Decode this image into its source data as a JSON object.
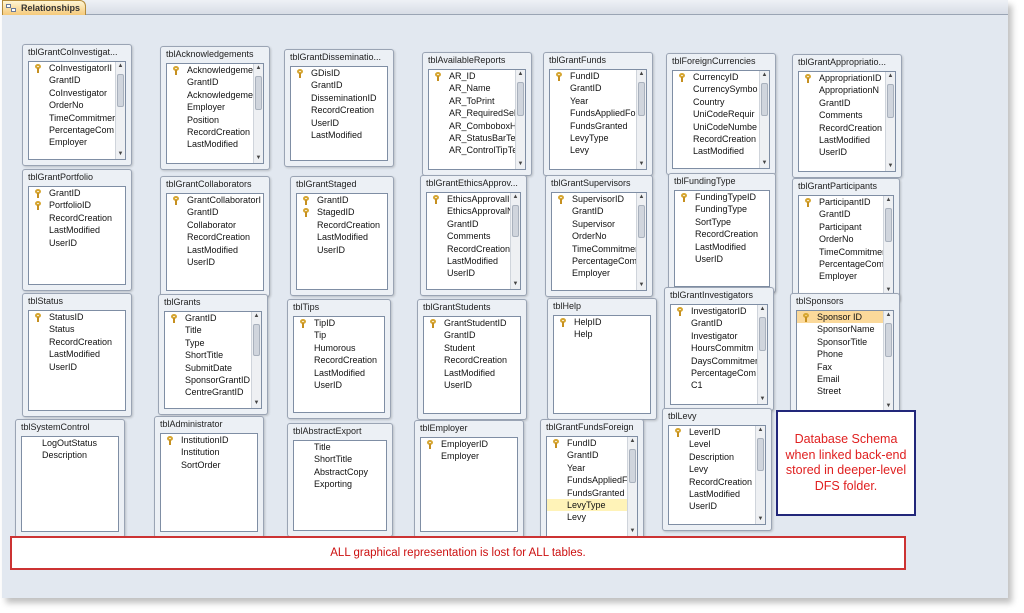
{
  "tab": {
    "label": "Relationships",
    "icon": "relationships-icon"
  },
  "tables": [
    {
      "name": "tblGrantCoInvestigat...",
      "fields": [
        "CoInvestigatorII",
        "GrantID",
        "CoInvestigator",
        "OrderNo",
        "TimeCommitmer",
        "PercentageCom",
        "Employer"
      ],
      "key": [
        0
      ],
      "scroll": true
    },
    {
      "name": "tblAcknowledgements",
      "fields": [
        "Acknowledgeme",
        "GrantID",
        "Acknowledgeme",
        "Employer",
        "Position",
        "RecordCreation",
        "LastModified"
      ],
      "key": [
        0
      ],
      "scroll": true
    },
    {
      "name": "tblGrantDisseminatio...",
      "fields": [
        "GDisID",
        "GrantID",
        "DisseminationID",
        "RecordCreation",
        "UserID",
        "LastModified"
      ],
      "key": [
        0
      ],
      "scroll": false
    },
    {
      "name": "tblAvailableReports",
      "fields": [
        "AR_ID",
        "AR_Name",
        "AR_ToPrint",
        "AR_RequiredSel",
        "AR_ComboboxH",
        "AR_StatusBarTe",
        "AR_ControlTipTe"
      ],
      "key": [
        0
      ],
      "scroll": true
    },
    {
      "name": "tblGrantFunds",
      "fields": [
        "FundID",
        "GrantID",
        "Year",
        "FundsAppliedFo",
        "FundsGranted",
        "LevyType",
        "Levy"
      ],
      "key": [
        0
      ],
      "scroll": true
    },
    {
      "name": "tblForeignCurrencies",
      "fields": [
        "CurrencyID",
        "CurrencySymbo",
        "Country",
        "UniCodeRequir",
        "UniCodeNumbe",
        "RecordCreation",
        "LastModified"
      ],
      "key": [
        0
      ],
      "scroll": true
    },
    {
      "name": "tblGrantAppropriatio...",
      "fields": [
        "AppropriationID",
        "AppropriationN",
        "GrantID",
        "Comments",
        "RecordCreation",
        "LastModified",
        "UserID"
      ],
      "key": [
        0
      ],
      "scroll": true
    },
    {
      "name": "tblGrantPortfolio",
      "fields": [
        "GrantID",
        "PortfolioID",
        "RecordCreation",
        "LastModified",
        "UserID"
      ],
      "key": [
        0,
        1
      ],
      "scroll": false
    },
    {
      "name": "tblGrantCollaborators",
      "fields": [
        "GrantCollaboratorI",
        "GrantID",
        "Collaborator",
        "RecordCreation",
        "LastModified",
        "UserID"
      ],
      "key": [
        0
      ],
      "scroll": false
    },
    {
      "name": "tblGrantStaged",
      "fields": [
        "GrantID",
        "StagedID",
        "RecordCreation",
        "LastModified",
        "UserID"
      ],
      "key": [
        0,
        1
      ],
      "scroll": false
    },
    {
      "name": "tblGrantEthicsApprov...",
      "fields": [
        "EthicsApprovalI",
        "EthicsApprovalN",
        "GrantID",
        "Comments",
        "RecordCreation",
        "LastModified",
        "UserID"
      ],
      "key": [
        0
      ],
      "scroll": true
    },
    {
      "name": "tblGrantSupervisors",
      "fields": [
        "SupervisorID",
        "GrantID",
        "Supervisor",
        "OrderNo",
        "TimeCommitmer",
        "PercentageCom",
        "Employer"
      ],
      "key": [
        0
      ],
      "scroll": true
    },
    {
      "name": "tblFundingType",
      "fields": [
        "FundingTypeID",
        "FundingType",
        "SortType",
        "RecordCreation",
        "LastModified",
        "UserID"
      ],
      "key": [
        0
      ],
      "scroll": false
    },
    {
      "name": "tblGrantParticipants",
      "fields": [
        "ParticipantID",
        "GrantID",
        "Participant",
        "OrderNo",
        "TimeCommitmer",
        "PercentageCom",
        "Employer"
      ],
      "key": [
        0
      ],
      "scroll": true
    },
    {
      "name": "tblStatus",
      "fields": [
        "StatusID",
        "Status",
        "RecordCreation",
        "LastModified",
        "UserID"
      ],
      "key": [
        0
      ],
      "scroll": false
    },
    {
      "name": "tblGrants",
      "fields": [
        "GrantID",
        "Title",
        "Type",
        "ShortTitle",
        "SubmitDate",
        "SponsorGrantID",
        "CentreGrantID"
      ],
      "key": [
        0
      ],
      "scroll": true
    },
    {
      "name": "tblTips",
      "fields": [
        "TipID",
        "Tip",
        "Humorous",
        "RecordCreation",
        "LastModified",
        "UserID"
      ],
      "key": [
        0
      ],
      "scroll": false
    },
    {
      "name": "tblGrantStudents",
      "fields": [
        "GrantStudentID",
        "GrantID",
        "Student",
        "RecordCreation",
        "LastModified",
        "UserID"
      ],
      "key": [
        0
      ],
      "scroll": false
    },
    {
      "name": "tblHelp",
      "fields": [
        "HelpID",
        "Help"
      ],
      "key": [
        0
      ],
      "scroll": false
    },
    {
      "name": "tblGrantInvestigators",
      "fields": [
        "InvestigatorID",
        "GrantID",
        "Investigator",
        "HoursCommitm",
        "DaysCommitmer",
        "PercentageCom",
        "C1"
      ],
      "key": [
        0
      ],
      "scroll": true
    },
    {
      "name": "tblSponsors",
      "fields": [
        "Sponsor ID",
        "SponsorName",
        "SponsorTitle",
        "Phone",
        "Fax",
        "Email",
        "Street"
      ],
      "key": [
        0
      ],
      "scroll": true
    },
    {
      "name": "tblSystemControl",
      "fields": [
        "LogOutStatus",
        "Description"
      ],
      "key": [],
      "scroll": false
    },
    {
      "name": "tblAdministrator",
      "fields": [
        "InstitutionID",
        "Institution",
        "SortOrder"
      ],
      "key": [
        0
      ],
      "scroll": false
    },
    {
      "name": "tblAbstractExport",
      "fields": [
        "Title",
        "ShortTitle",
        "AbstractCopy",
        "Exporting"
      ],
      "key": [],
      "scroll": false
    },
    {
      "name": "tblEmployer",
      "fields": [
        "EmployerID",
        "Employer"
      ],
      "key": [
        0
      ],
      "scroll": false
    },
    {
      "name": "tblGrantFundsForeign",
      "fields": [
        "FundID",
        "GrantID",
        "Year",
        "FundsAppliedF",
        "FundsGranted",
        "LevyType",
        "Levy"
      ],
      "key": [
        0
      ],
      "scroll": true
    },
    {
      "name": "tblLevy",
      "fields": [
        "LeverID",
        "Level",
        "Description",
        "Levy",
        "RecordCreation",
        "LastModified",
        "UserID"
      ],
      "key": [
        0
      ],
      "scroll": true
    }
  ],
  "note": "Database Schema when linked back-end stored in deeper-level DFS folder.",
  "banner": "ALL  graphical representation is lost for ALL tables.",
  "colors": {
    "note_border": "#22277a",
    "note_text": "#e02020",
    "banner_border": "#cc3333",
    "banner_text": "#cc1010"
  }
}
